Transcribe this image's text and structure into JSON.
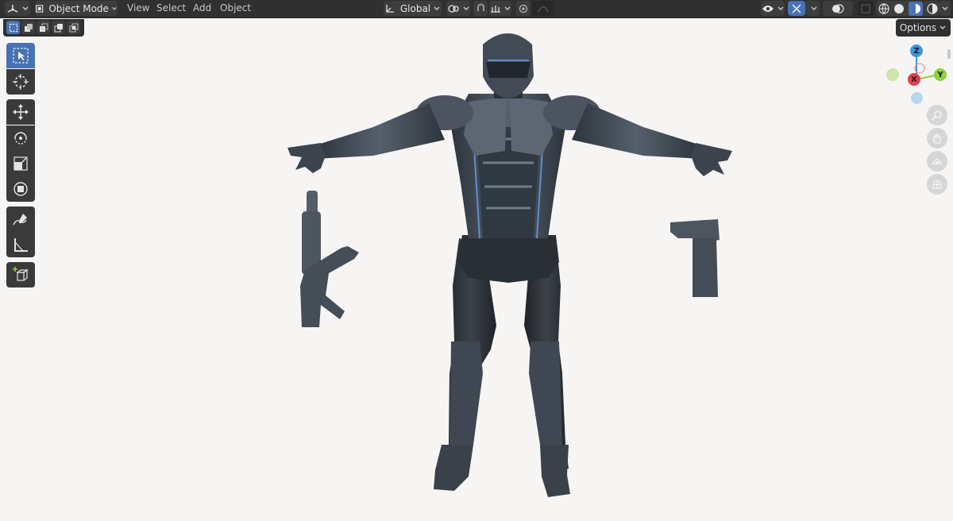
{
  "header": {
    "editor_type_icon": "3d-viewport-icon",
    "mode_label": "Object Mode",
    "menus": [
      "View",
      "Select",
      "Add",
      "Object"
    ],
    "transform_orientation": "Global",
    "pivot_icon": "pivot-icon",
    "snap_icon": "magnet-icon",
    "snap_increment_icon": "snap-increment-icon",
    "proportional_icon": "proportional-editing-icon",
    "visibility_icon": "eye-icon",
    "gizmo_icon": "gizmo-icon",
    "overlay_icon": "overlay-icon",
    "xray_icon": "xray-icon",
    "shading_modes": [
      "wireframe",
      "solid",
      "material-preview",
      "rendered"
    ],
    "active_shading": "material-preview"
  },
  "subheader": {
    "selection_modes": [
      "select-new-icon",
      "extend-icon",
      "subtract-icon",
      "invert-icon",
      "intersect-icon"
    ],
    "options_label": "Options"
  },
  "toolbar": {
    "tools": [
      "select-box-icon",
      "cursor-icon",
      "move-icon",
      "rotate-icon",
      "scale-icon",
      "transform-icon",
      "annotate-icon",
      "measure-icon",
      "add-cube-icon"
    ],
    "active_tool": "select-box-icon"
  },
  "gizmo": {
    "axes": [
      "X",
      "Y",
      "Z"
    ],
    "colors": {
      "x": "#e53e4e",
      "y": "#8ed13a",
      "z": "#3f95e0",
      "neg_y": "#cfe6a8",
      "neg_x": "#f0b8bd",
      "neg_z": "#b9d5f2"
    }
  },
  "nav_buttons": [
    "zoom-icon",
    "pan-hand-icon",
    "camera-icon",
    "grid-perspective-icon"
  ],
  "colors": {
    "header_bg": "#303030",
    "accent": "#4772b3",
    "viewport_bg": "#f7f5f4",
    "armor": "#3c4550",
    "armor_light": "#59636f",
    "glow": "#5f8fcf"
  }
}
